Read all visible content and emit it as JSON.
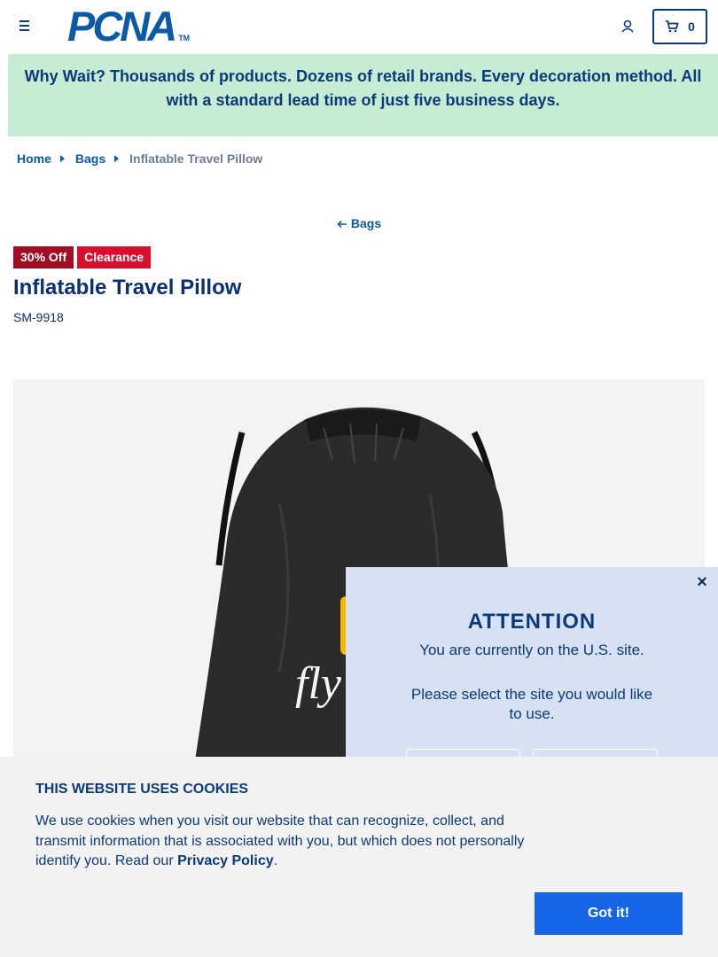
{
  "header": {
    "logo_text": "PCNA",
    "logo_tm": "TM",
    "cart_count": "0"
  },
  "promo": {
    "text": "Why Wait? Thousands of products. Dozens of retail brands. Every decoration method. All with a standard lead time of just five business days."
  },
  "breadcrumb": {
    "items": [
      "Home",
      "Bags"
    ],
    "current": "Inflatable Travel Pillow"
  },
  "back_link": {
    "label": "Bags"
  },
  "product": {
    "badges": [
      "30% Off",
      "Clearance"
    ],
    "title": "Inflatable Travel Pillow",
    "sku": "SM-9918",
    "image_imprint": "fly"
  },
  "attention_popup": {
    "title": "ATTENTION",
    "line1": "You are currently on the U.S. site.",
    "line2": "Please select the site you would like to use.",
    "close_label": "×"
  },
  "cookie_banner": {
    "title": "THIS WEBSITE USES COOKIES",
    "text": "We use cookies when you visit our website that can recognize, collect, and transmit information that is associated with you, but which does not personally identify you. Read our ",
    "policy_link": "Privacy Policy",
    "text_end": ".",
    "button_label": "Got it!"
  },
  "colors": {
    "brand_blue": "#0a5aa8",
    "navy": "#0b3a78",
    "promo_bg": "#c6ecd4",
    "badge_off": "#a30d24",
    "badge_clearance": "#d8102e",
    "popup_bg": "#d6e1f4",
    "cookie_button": "#1565e6"
  },
  "icons": [
    "menu-icon",
    "account-icon",
    "cart-icon",
    "breadcrumb-arrow-icon",
    "back-arrow-icon",
    "close-icon"
  ]
}
